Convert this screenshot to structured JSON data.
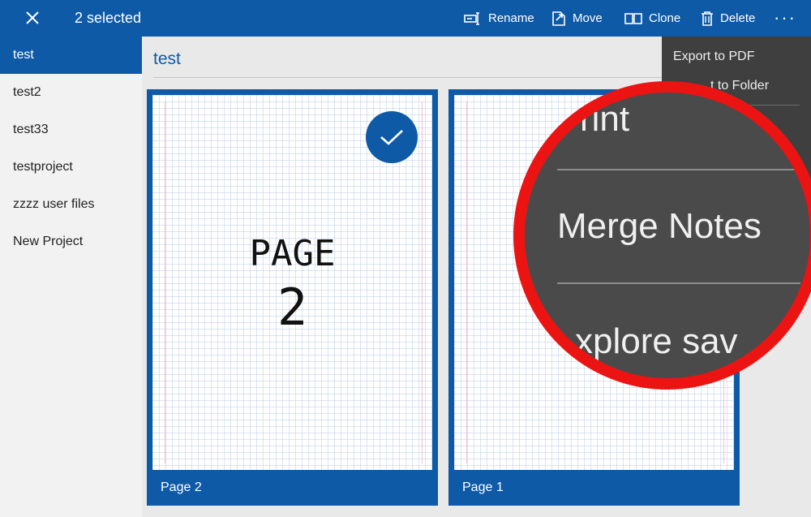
{
  "toolbar": {
    "selection_text": "2 selected",
    "rename_label": "Rename",
    "move_label": "Move",
    "clone_label": "Clone",
    "delete_label": "Delete",
    "more_label": "···"
  },
  "sidebar": {
    "items": [
      {
        "label": "test"
      },
      {
        "label": "test2"
      },
      {
        "label": "test33"
      },
      {
        "label": "testproject"
      },
      {
        "label": "zzzz user files"
      },
      {
        "label": "New Project"
      }
    ]
  },
  "main": {
    "folder_title": "test",
    "pages": [
      {
        "label": "Page 2",
        "line1": "PAGE",
        "line2": "2"
      },
      {
        "label": "Page 1"
      }
    ]
  },
  "menu": {
    "items": [
      {
        "label": "Export to PDF"
      },
      {
        "label": "t to Folder"
      }
    ]
  },
  "magnifier": {
    "top_fragment": "rint",
    "merge_label": "Merge Notes",
    "bottom_fragment": "xplore sav"
  },
  "colors": {
    "accent": "#0e5aa7",
    "menu_bg": "#3f3f3f",
    "highlight_ring": "#ec1313"
  }
}
